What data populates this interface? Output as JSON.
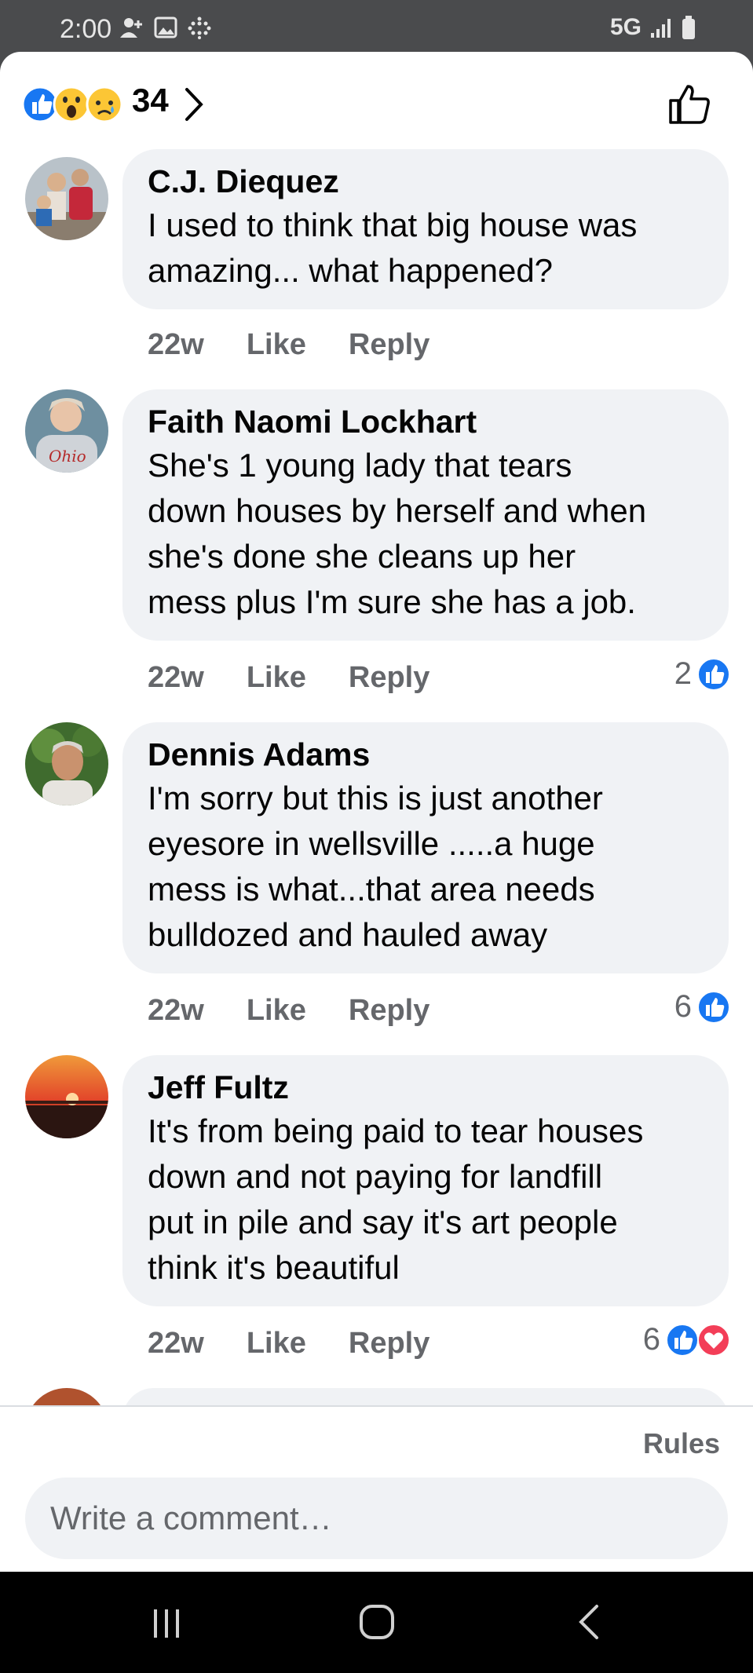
{
  "status": {
    "time": "2:00",
    "network": "5G"
  },
  "reactions": {
    "count": "34"
  },
  "comments": [
    {
      "name": "C.J. Diequez",
      "text": [
        "I used to think that big house was",
        "amazing... what happened?"
      ],
      "time": "22w",
      "like": "Like",
      "reply": "Reply",
      "reaction_count": ""
    },
    {
      "name": "Faith Naomi Lockhart",
      "text": [
        "She's 1 young lady that tears",
        "down houses by herself and when",
        "she's done she cleans up her",
        "mess plus I'm sure she has a job."
      ],
      "time": "22w",
      "like": "Like",
      "reply": "Reply",
      "reaction_count": "2"
    },
    {
      "name": "Dennis Adams",
      "text": [
        "I'm sorry but this is just another",
        "eyesore in wellsville .....a huge",
        "mess is what...that area needs",
        "bulldozed and hauled away"
      ],
      "time": "22w",
      "like": "Like",
      "reply": "Reply",
      "reaction_count": "6"
    },
    {
      "name": "Jeff Fultz",
      "text": [
        "It's from being paid to tear houses",
        "down and not paying for landfill",
        "put in pile and say it's art people",
        "think it's beautiful"
      ],
      "time": "22w",
      "like": "Like",
      "reply": "Reply",
      "reaction_count": "6"
    }
  ],
  "footer": {
    "rules": "Rules",
    "placeholder": "Write a comment…"
  },
  "colors": {
    "like_blue": "#1877f2",
    "love_red": "#f33e58",
    "bubble_bg": "#f0f2f5",
    "secondary_text": "#65676b"
  },
  "icons": [
    "like-reaction-icon",
    "wow-reaction-icon",
    "sad-reaction-icon",
    "thumbs-up-icon",
    "love-reaction-icon",
    "chevron-right-icon"
  ]
}
